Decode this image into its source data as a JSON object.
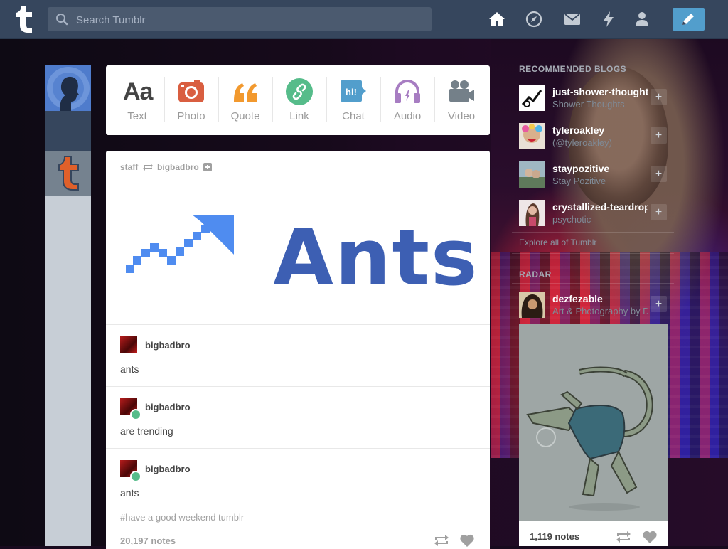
{
  "search": {
    "placeholder": "Search Tumblr"
  },
  "nav": [
    {
      "name": "home-icon"
    },
    {
      "name": "explore-icon"
    },
    {
      "name": "inbox-icon"
    },
    {
      "name": "activity-icon"
    },
    {
      "name": "account-icon"
    }
  ],
  "composer": {
    "types": [
      {
        "label": "Text",
        "icon": "text-icon",
        "color": "#444444",
        "glyph": "Aa"
      },
      {
        "label": "Photo",
        "icon": "camera-icon",
        "color": "#d95e40"
      },
      {
        "label": "Quote",
        "icon": "quote-icon",
        "color": "#f2992e",
        "glyph": "❝"
      },
      {
        "label": "Link",
        "icon": "link-icon",
        "color": "#56bc8a"
      },
      {
        "label": "Chat",
        "icon": "chat-icon",
        "color": "#529ecc",
        "glyph": "hi!"
      },
      {
        "label": "Audio",
        "icon": "headphones-icon",
        "color": "#a77dc2"
      },
      {
        "label": "Video",
        "icon": "video-camera-icon",
        "color": "#748089"
      }
    ]
  },
  "post": {
    "author": "staff",
    "reblogged_from": "bigbadbro",
    "image_text": "Ants",
    "reblogs": [
      {
        "name": "bigbadbro",
        "text": "ants"
      },
      {
        "name": "bigbadbro",
        "text": "are trending"
      },
      {
        "name": "bigbadbro",
        "text": "ants"
      }
    ],
    "tags": "#have a good weekend tumblr",
    "notes": "20,197 notes"
  },
  "sidebar": {
    "recommended_heading": "RECOMMENDED BLOGS",
    "blogs": [
      {
        "name": "just-shower-thoughts",
        "sub": "Shower Thoughts"
      },
      {
        "name": "tyleroakley",
        "sub": "(@tyleroakley)"
      },
      {
        "name": "staypozitive",
        "sub": "Stay Pozitive"
      },
      {
        "name": "crystallized-teardrops",
        "sub": "psychotic"
      }
    ],
    "explore": "Explore all of Tumblr",
    "radar_heading": "RADAR",
    "radar": {
      "name": "dezfezable",
      "sub": "Art & Photography by Dez",
      "notes": "1,119 notes"
    }
  }
}
